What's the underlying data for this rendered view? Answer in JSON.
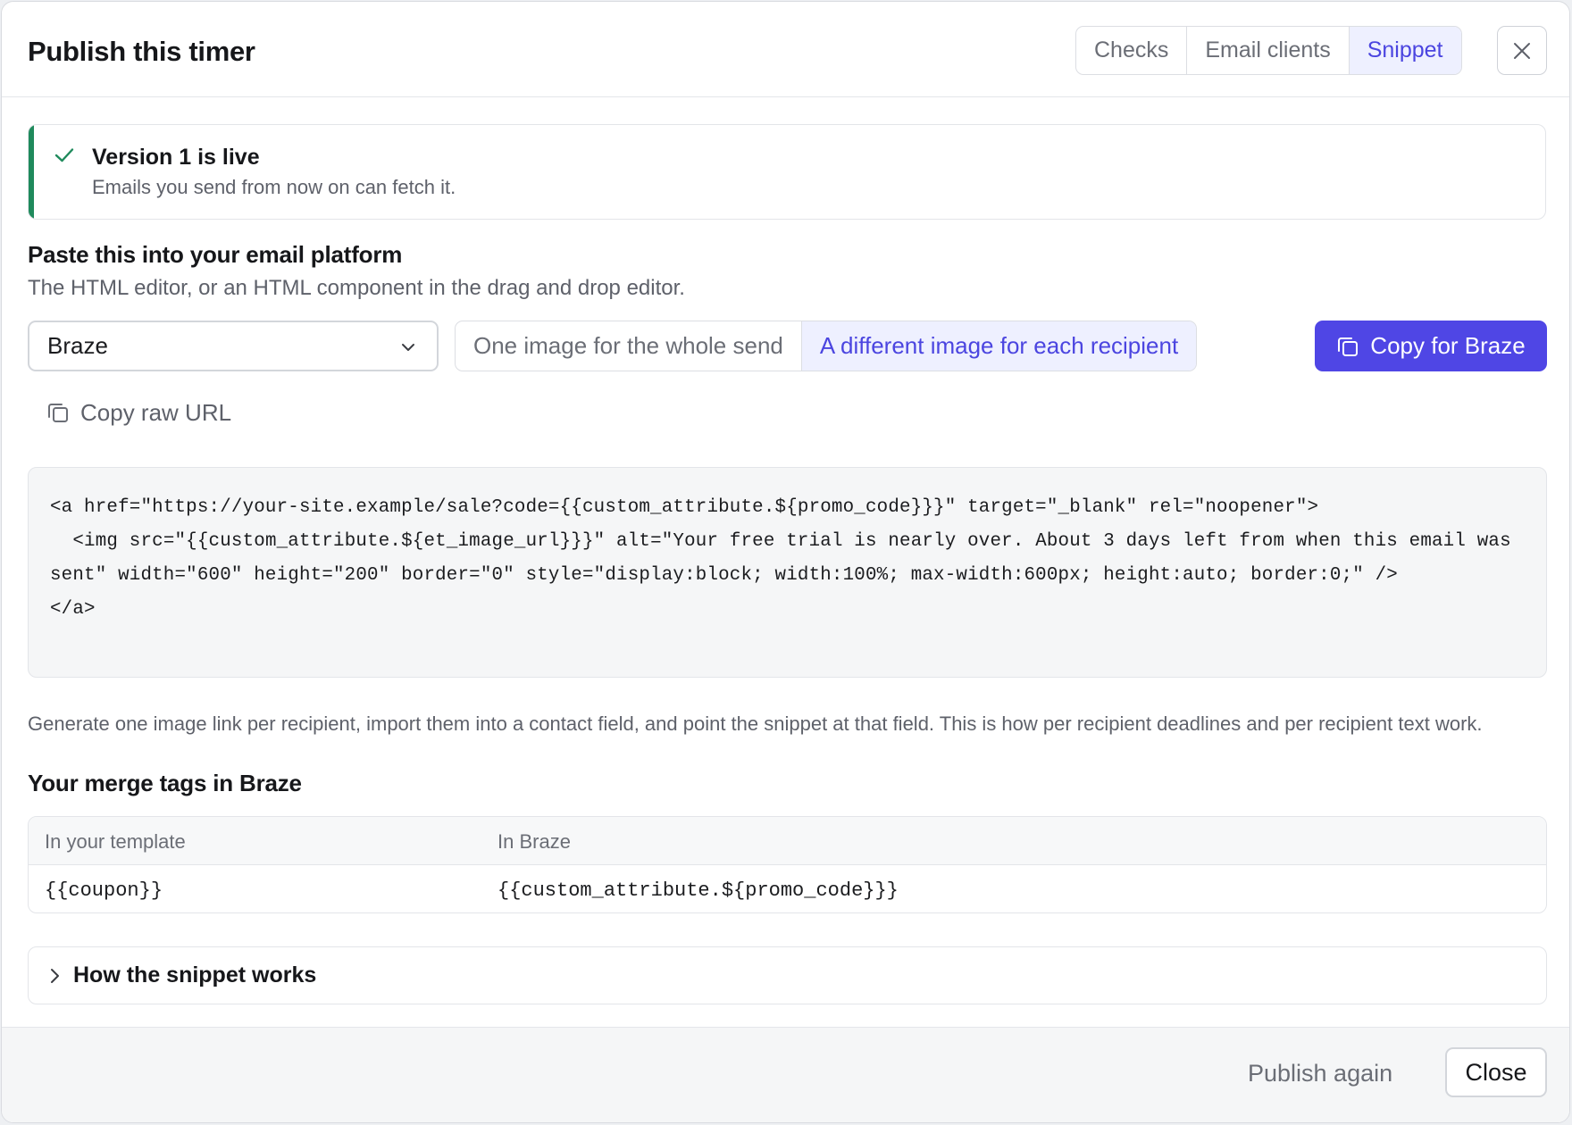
{
  "dialog": {
    "title": "Publish this timer",
    "tabs": [
      {
        "label": "Checks",
        "active": false
      },
      {
        "label": "Email clients",
        "active": false
      },
      {
        "label": "Snippet",
        "active": true
      }
    ],
    "close_icon": "close-icon"
  },
  "banner": {
    "icon": "check-icon",
    "title": "Version 1 is live",
    "subtitle": "Emails you send from now on can fetch it.",
    "accent": "#1f8a5c"
  },
  "paste": {
    "heading": "Paste this into your email platform",
    "subheading": "The HTML editor, or an HTML component in the drag and drop editor.",
    "platform": "Braze",
    "mode_options": [
      {
        "label": "One image for the whole send",
        "active": false
      },
      {
        "label": "A different image for each recipient",
        "active": true
      }
    ],
    "copy_button": "Copy for Braze",
    "copy_raw": "Copy raw URL",
    "accent": "#4f46e5"
  },
  "code": {
    "snippet": "<a href=\"https://your-site.example/sale?code={{custom_attribute.${promo_code}}}\" target=\"_blank\" rel=\"noopener\">\n  <img src=\"{{custom_attribute.${et_image_url}}}\" alt=\"Your free trial is nearly over. About 3 days left from when this email was sent\" width=\"600\" height=\"200\" border=\"0\" style=\"display:block; width:100%; max-width:600px; height:auto; border:0;\" />\n</a>"
  },
  "note": "Generate one image link per recipient, import them into a contact field, and point the snippet at that field. This is how per recipient deadlines and per recipient text work.",
  "merge": {
    "heading": "Your merge tags in Braze",
    "columns": [
      "In your template",
      "In Braze"
    ],
    "rows": [
      [
        "{{coupon}}",
        "{{custom_attribute.${promo_code}}}"
      ]
    ]
  },
  "details": {
    "label": "How the snippet works",
    "icon": "chevron-right-icon"
  },
  "footer": {
    "publish_again": "Publish again",
    "close": "Close"
  }
}
